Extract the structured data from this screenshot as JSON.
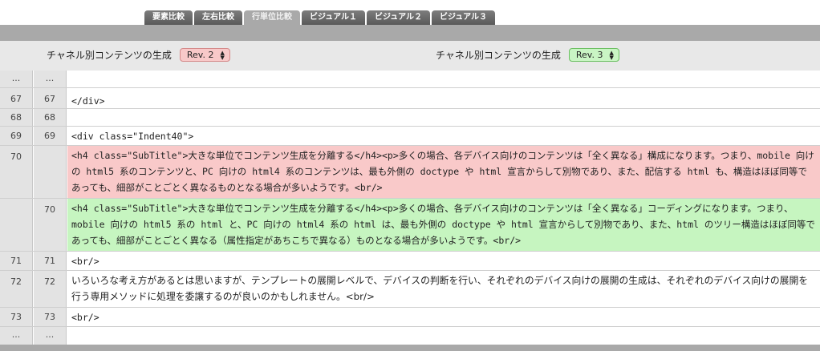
{
  "tabs": [
    {
      "label": "要素比較",
      "active": false
    },
    {
      "label": "左右比較",
      "active": false
    },
    {
      "label": "行単位比較",
      "active": true
    },
    {
      "label": "ビジュアル１",
      "active": false
    },
    {
      "label": "ビジュアル２",
      "active": false
    },
    {
      "label": "ビジュアル３",
      "active": false
    }
  ],
  "left": {
    "title": "チャネル別コンテンツの生成",
    "rev": "Rev. 2"
  },
  "right": {
    "title": "チャネル別コンテンツの生成",
    "rev": "Rev. 3"
  },
  "rows": [
    {
      "a": "...",
      "b": "...",
      "code": ""
    },
    {
      "a": "67",
      "b": "67",
      "code": "</div>"
    },
    {
      "a": "68",
      "b": "68",
      "code": ""
    },
    {
      "a": "69",
      "b": "69",
      "code": "<div class=\"Indent40\">"
    },
    {
      "a": "70",
      "b": "",
      "code": "<h4 class=\"SubTitle\">大きな単位でコンテンツ生成を分離する</h4><p>多くの場合、各デバイス向けのコンテンツは「全く異なる」構成になります。つまり、mobile 向けの html5 系のコンテンツと、PC 向けの html4 系のコンテンツは、最も外側の doctype や html 宣言からして別物であり、また、配信する html も、構造はほぼ同等であっても、細部がことごとく異なるものとなる場合が多いようです。<br/>"
    },
    {
      "a": "",
      "b": "70",
      "code": "<h4 class=\"SubTitle\">大きな単位でコンテンツ生成を分離する</h4><p>多くの場合、各デバイス向けのコンテンツは「全く異なる」コーディングになります。つまり、mobile 向けの html5 系の html と、PC 向けの html4 系の html は、最も外側の doctype や html 宣言からして別物であり、また、html のツリー構造はほぼ同等であっても、細部がことごとく異なる（属性指定があちこちで異なる）ものとなる場合が多いようです。<br/>"
    },
    {
      "a": "71",
      "b": "71",
      "code": "<br/>"
    },
    {
      "a": "72",
      "b": "72",
      "code": "いろいろな考え方があるとは思いますが、テンプレートの展開レベルで、デバイスの判断を行い、それぞれのデバイス向けの展開の生成は、それぞれのデバイス向けの展開を行う専用メソッドに処理を委譲するのが良いのかもしれません。<br/>"
    },
    {
      "a": "73",
      "b": "73",
      "code": "<br/>"
    },
    {
      "a": "...",
      "b": "...",
      "code": ""
    }
  ]
}
